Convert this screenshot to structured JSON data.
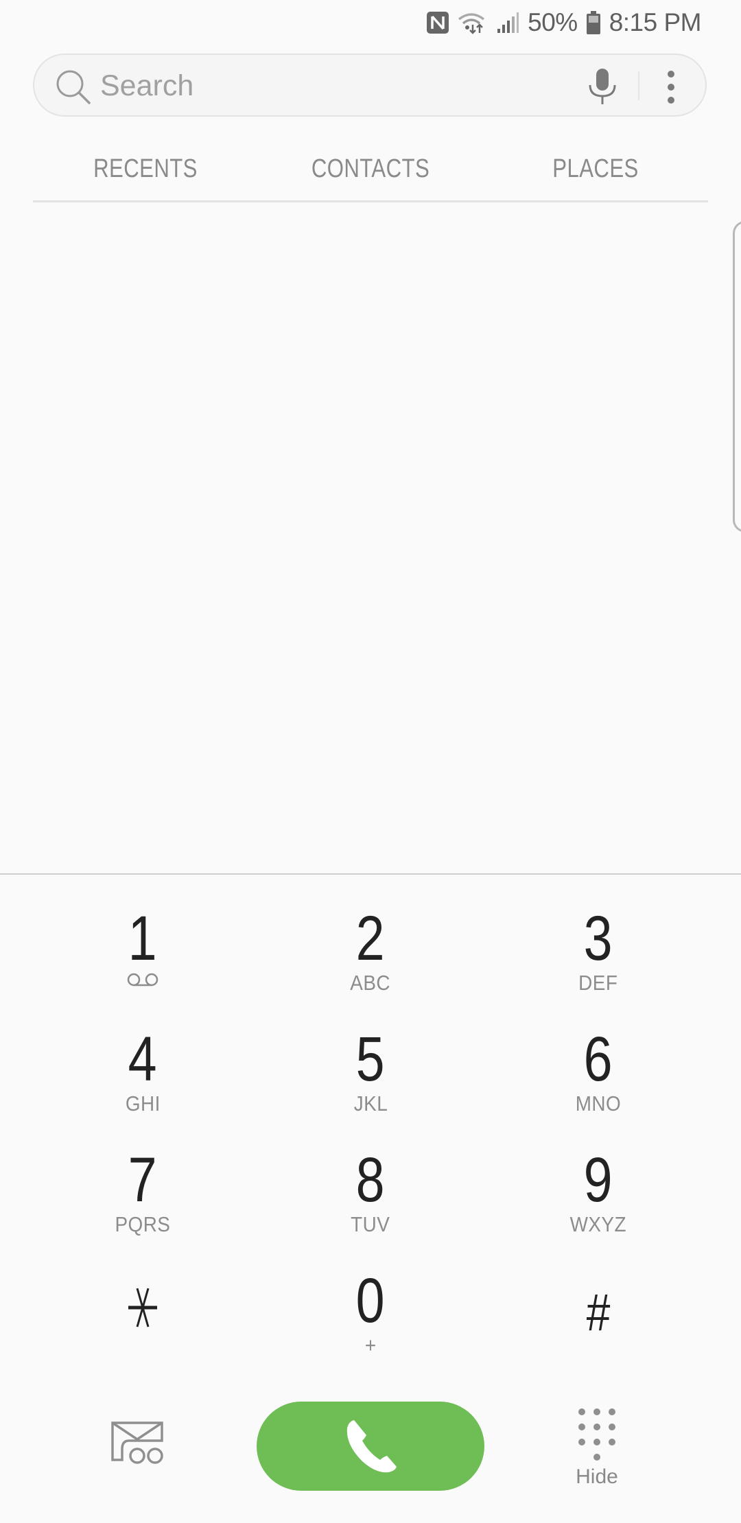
{
  "status_bar": {
    "nfc_icon": "nfc-icon",
    "wifi_icon": "wifi-data-icon",
    "signal_icon": "cell-signal-icon",
    "battery_percent": "50%",
    "battery_icon": "battery-icon",
    "time": "8:15 PM"
  },
  "search": {
    "placeholder": "Search",
    "value": "",
    "search_icon": "search-icon",
    "mic_icon": "mic-icon",
    "more_icon": "more-vert-icon"
  },
  "tabs": [
    {
      "label": "RECENTS"
    },
    {
      "label": "CONTACTS"
    },
    {
      "label": "PLACES"
    }
  ],
  "keypad": {
    "keys": [
      {
        "digit": "1",
        "letters": "",
        "sub_icon": "voicemail-icon"
      },
      {
        "digit": "2",
        "letters": "ABC"
      },
      {
        "digit": "3",
        "letters": "DEF"
      },
      {
        "digit": "4",
        "letters": "GHI"
      },
      {
        "digit": "5",
        "letters": "JKL"
      },
      {
        "digit": "6",
        "letters": "MNO"
      },
      {
        "digit": "7",
        "letters": "PQRS"
      },
      {
        "digit": "8",
        "letters": "TUV"
      },
      {
        "digit": "9",
        "letters": "WXYZ"
      },
      {
        "digit": "*",
        "letters": ""
      },
      {
        "digit": "0",
        "letters": "+"
      },
      {
        "digit": "#",
        "letters": ""
      }
    ]
  },
  "actions": {
    "voicemail_icon": "video-voicemail-icon",
    "call_icon": "phone-icon",
    "call_color": "#6fbd55",
    "hide_label": "Hide",
    "hide_icon": "dialpad-icon"
  }
}
